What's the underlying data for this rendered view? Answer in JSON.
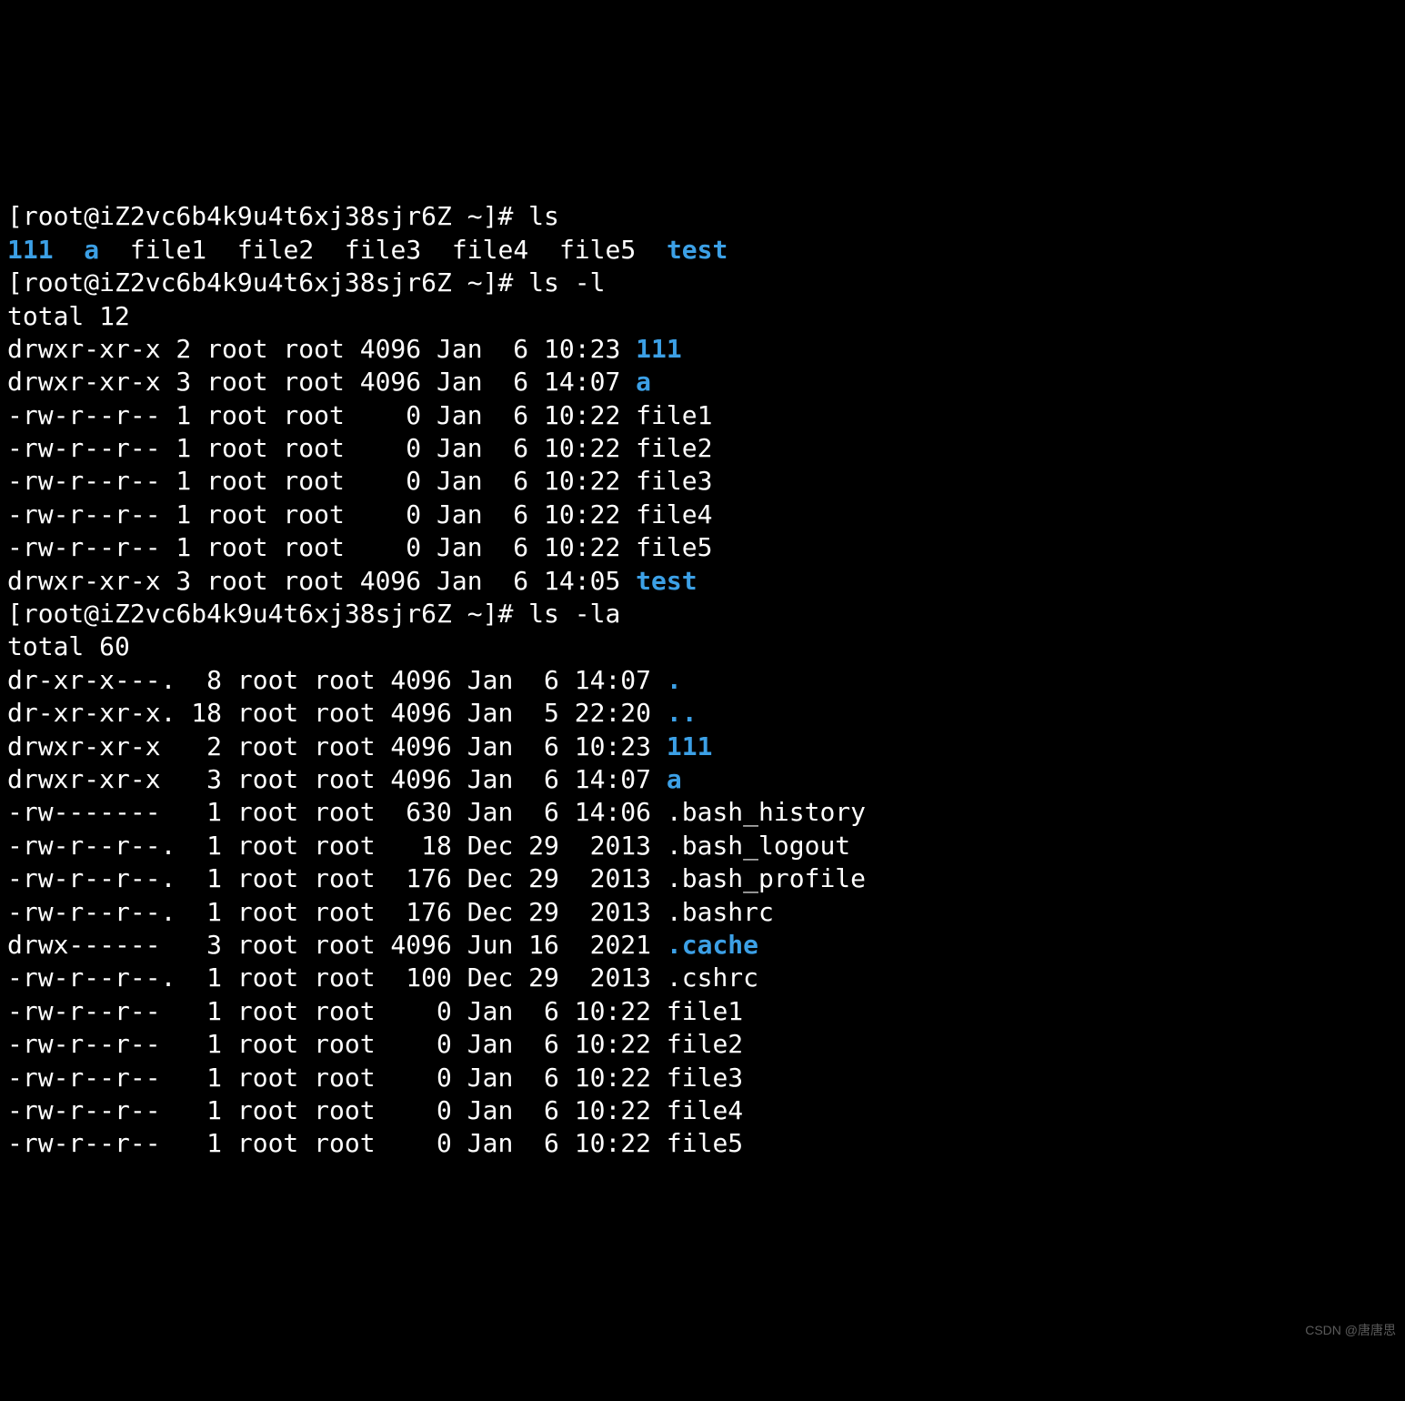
{
  "prompt": "[root@iZ2vc6b4k9u4t6xj38sjr6Z ~]# ",
  "commands": {
    "ls": "ls",
    "ls_l": "ls -l",
    "ls_la": "ls -la"
  },
  "ls_output": [
    {
      "name": "111",
      "type": "dir"
    },
    {
      "name": "a",
      "type": "dir"
    },
    {
      "name": "file1",
      "type": "file"
    },
    {
      "name": "file2",
      "type": "file"
    },
    {
      "name": "file3",
      "type": "file"
    },
    {
      "name": "file4",
      "type": "file"
    },
    {
      "name": "file5",
      "type": "file"
    },
    {
      "name": "test",
      "type": "dir"
    }
  ],
  "ls_l_total": "total 12",
  "ls_l": [
    {
      "perm": "drwxr-xr-x",
      "links": "2",
      "owner": "root",
      "group": "root",
      "size": "4096",
      "month": "Jan",
      "day": " 6",
      "time": "10:23",
      "name": "111",
      "type": "dir"
    },
    {
      "perm": "drwxr-xr-x",
      "links": "3",
      "owner": "root",
      "group": "root",
      "size": "4096",
      "month": "Jan",
      "day": " 6",
      "time": "14:07",
      "name": "a",
      "type": "dir"
    },
    {
      "perm": "-rw-r--r--",
      "links": "1",
      "owner": "root",
      "group": "root",
      "size": "0",
      "month": "Jan",
      "day": " 6",
      "time": "10:22",
      "name": "file1",
      "type": "file"
    },
    {
      "perm": "-rw-r--r--",
      "links": "1",
      "owner": "root",
      "group": "root",
      "size": "0",
      "month": "Jan",
      "day": " 6",
      "time": "10:22",
      "name": "file2",
      "type": "file"
    },
    {
      "perm": "-rw-r--r--",
      "links": "1",
      "owner": "root",
      "group": "root",
      "size": "0",
      "month": "Jan",
      "day": " 6",
      "time": "10:22",
      "name": "file3",
      "type": "file"
    },
    {
      "perm": "-rw-r--r--",
      "links": "1",
      "owner": "root",
      "group": "root",
      "size": "0",
      "month": "Jan",
      "day": " 6",
      "time": "10:22",
      "name": "file4",
      "type": "file"
    },
    {
      "perm": "-rw-r--r--",
      "links": "1",
      "owner": "root",
      "group": "root",
      "size": "0",
      "month": "Jan",
      "day": " 6",
      "time": "10:22",
      "name": "file5",
      "type": "file"
    },
    {
      "perm": "drwxr-xr-x",
      "links": "3",
      "owner": "root",
      "group": "root",
      "size": "4096",
      "month": "Jan",
      "day": " 6",
      "time": "14:05",
      "name": "test",
      "type": "dir"
    }
  ],
  "ls_la_total": "total 60",
  "ls_la": [
    {
      "perm": "dr-xr-x---.",
      "links": "8",
      "owner": "root",
      "group": "root",
      "size": "4096",
      "month": "Jan",
      "day": " 6",
      "time": "14:07",
      "name": ".",
      "type": "dir"
    },
    {
      "perm": "dr-xr-xr-x.",
      "links": "18",
      "owner": "root",
      "group": "root",
      "size": "4096",
      "month": "Jan",
      "day": " 5",
      "time": "22:20",
      "name": "..",
      "type": "dir"
    },
    {
      "perm": "drwxr-xr-x",
      "links": "2",
      "owner": "root",
      "group": "root",
      "size": "4096",
      "month": "Jan",
      "day": " 6",
      "time": "10:23",
      "name": "111",
      "type": "dir"
    },
    {
      "perm": "drwxr-xr-x",
      "links": "3",
      "owner": "root",
      "group": "root",
      "size": "4096",
      "month": "Jan",
      "day": " 6",
      "time": "14:07",
      "name": "a",
      "type": "dir"
    },
    {
      "perm": "-rw-------",
      "links": "1",
      "owner": "root",
      "group": "root",
      "size": "630",
      "month": "Jan",
      "day": " 6",
      "time": "14:06",
      "name": ".bash_history",
      "type": "file"
    },
    {
      "perm": "-rw-r--r--.",
      "links": "1",
      "owner": "root",
      "group": "root",
      "size": "18",
      "month": "Dec",
      "day": "29",
      "time": " 2013",
      "name": ".bash_logout",
      "type": "file"
    },
    {
      "perm": "-rw-r--r--.",
      "links": "1",
      "owner": "root",
      "group": "root",
      "size": "176",
      "month": "Dec",
      "day": "29",
      "time": " 2013",
      "name": ".bash_profile",
      "type": "file"
    },
    {
      "perm": "-rw-r--r--.",
      "links": "1",
      "owner": "root",
      "group": "root",
      "size": "176",
      "month": "Dec",
      "day": "29",
      "time": " 2013",
      "name": ".bashrc",
      "type": "file"
    },
    {
      "perm": "drwx------",
      "links": "3",
      "owner": "root",
      "group": "root",
      "size": "4096",
      "month": "Jun",
      "day": "16",
      "time": " 2021",
      "name": ".cache",
      "type": "dir"
    },
    {
      "perm": "-rw-r--r--.",
      "links": "1",
      "owner": "root",
      "group": "root",
      "size": "100",
      "month": "Dec",
      "day": "29",
      "time": " 2013",
      "name": ".cshrc",
      "type": "file"
    },
    {
      "perm": "-rw-r--r--",
      "links": "1",
      "owner": "root",
      "group": "root",
      "size": "0",
      "month": "Jan",
      "day": " 6",
      "time": "10:22",
      "name": "file1",
      "type": "file"
    },
    {
      "perm": "-rw-r--r--",
      "links": "1",
      "owner": "root",
      "group": "root",
      "size": "0",
      "month": "Jan",
      "day": " 6",
      "time": "10:22",
      "name": "file2",
      "type": "file"
    },
    {
      "perm": "-rw-r--r--",
      "links": "1",
      "owner": "root",
      "group": "root",
      "size": "0",
      "month": "Jan",
      "day": " 6",
      "time": "10:22",
      "name": "file3",
      "type": "file"
    },
    {
      "perm": "-rw-r--r--",
      "links": "1",
      "owner": "root",
      "group": "root",
      "size": "0",
      "month": "Jan",
      "day": " 6",
      "time": "10:22",
      "name": "file4",
      "type": "file"
    },
    {
      "perm": "-rw-r--r--",
      "links": "1",
      "owner": "root",
      "group": "root",
      "size": "0",
      "month": "Jan",
      "day": " 6",
      "time": "10:22",
      "name": "file5",
      "type": "file"
    }
  ],
  "watermark": "CSDN @唐唐思"
}
